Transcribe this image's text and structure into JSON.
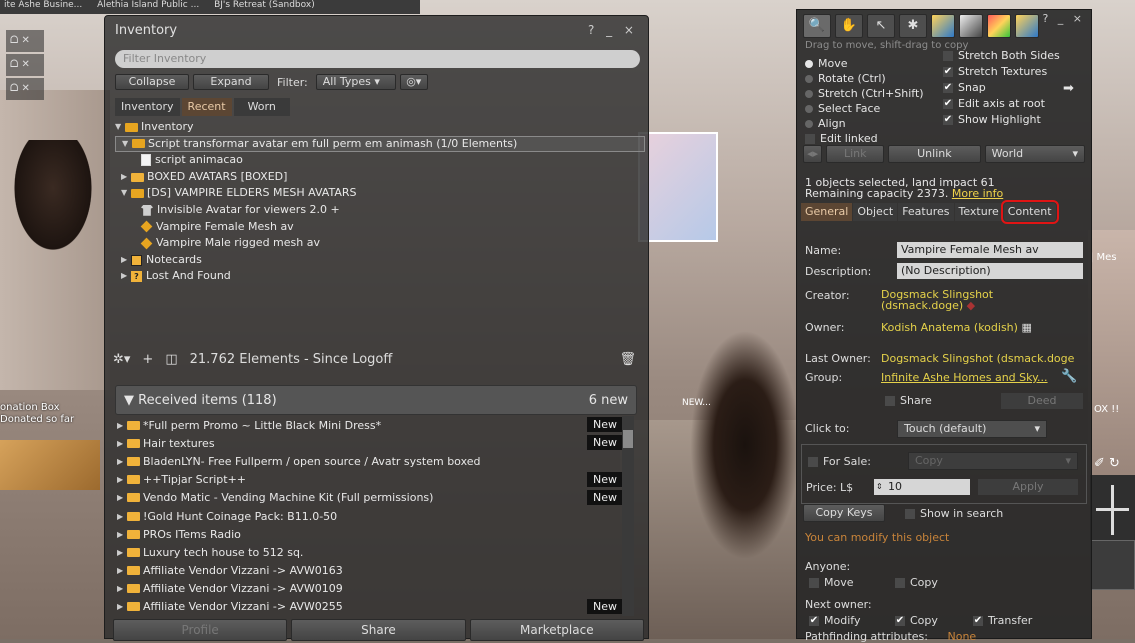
{
  "world": {
    "top_tabs": [
      "ite Ashe Busine...",
      "Alethia Island Public ...",
      "BJ's Retreat (Sandbox)"
    ],
    "left_icons": [
      "ᗝ ✕",
      "ᗝ ✕",
      "ᗝ ✕"
    ],
    "donation_line1": "onation Box",
    "donation_line2": "Donated so far",
    "new_label": "NEW...",
    "mes_label": "| Mes",
    "ox_label": "OX !!",
    "cam_glyph": "✐ ↻"
  },
  "inventory": {
    "title": "Inventory",
    "window_controls": "? _ ×",
    "filter_placeholder": "Filter Inventory",
    "collapse_label": "Collapse",
    "expand_label": "Expand",
    "filter_label": "Filter:",
    "filter_type": "All Types",
    "tabs": [
      "Inventory",
      "Recent",
      "Worn"
    ],
    "tree": [
      {
        "label": "Inventory"
      },
      {
        "label": "Script transformar avatar em full perm em animash (1/0 Elements)"
      },
      {
        "label": "script animacao"
      },
      {
        "label": "BOXED AVATARS [BOXED]"
      },
      {
        "label": "[DS] VAMPIRE ELDERS MESH AVATARS"
      },
      {
        "label": "Invisible Avatar for viewers 2.0 +"
      },
      {
        "label": "Vampire Female Mesh av"
      },
      {
        "label": "Vampire Male rigged mesh av"
      },
      {
        "label": "Notecards"
      },
      {
        "label": "Lost And Found"
      }
    ],
    "status_count": "21.762 Elements",
    "status_since": "- Since Logoff",
    "received_title": "Received items (118)",
    "received_new": "6 new",
    "received": [
      {
        "label": "*Full perm Promo ~ Little Black Mini Dress*",
        "tag": "New"
      },
      {
        "label": "Hair textures",
        "tag": "New"
      },
      {
        "label": "BladenLYN- Free Fullperm / open source / Avatr system boxed",
        "tag": ""
      },
      {
        "label": "++Tipjar Script++",
        "tag": "New"
      },
      {
        "label": "Vendo Matic - Vending Machine Kit (Full permissions)",
        "tag": "New"
      },
      {
        "label": "!Gold Hunt Coinage Pack: B11.0-50",
        "tag": ""
      },
      {
        "label": "PROs ITems Radio",
        "tag": ""
      },
      {
        "label": "Luxury tech house to 512 sq.",
        "tag": ""
      },
      {
        "label": "Affiliate Vendor Vizzani -> AVW0163",
        "tag": ""
      },
      {
        "label": "Affiliate Vendor Vizzani -> AVW0109",
        "tag": ""
      },
      {
        "label": "Affiliate Vendor Vizzani -> AVW0255",
        "tag": "New"
      }
    ],
    "bottom_buttons": [
      "Profile",
      "Share",
      "Marketplace"
    ]
  },
  "build": {
    "window_controls": "? _ ×",
    "drag_tip": "Drag to move, shift-drag to copy",
    "move": "Move",
    "rotate": "Rotate (Ctrl)",
    "stretch": "Stretch (Ctrl+Shift)",
    "select_face": "Select Face",
    "align": "Align",
    "edit_linked": "Edit linked",
    "stretch_both": "Stretch Both Sides",
    "stretch_textures": "Stretch Textures",
    "snap": "Snap",
    "edit_axis": "Edit axis at root",
    "show_highlight": "Show Highlight",
    "link_label": "Link",
    "unlink_label": "Unlink",
    "world_label": "World",
    "info_line1": "1 objects selected, land impact 61",
    "info_line2": "Remaining capacity 2373.",
    "more_info": "More info",
    "tabs": [
      "General",
      "Object",
      "Features",
      "Texture",
      "Content"
    ],
    "name_label": "Name:",
    "name_value": "Vampire Female Mesh av",
    "desc_label": "Description:",
    "desc_value": "(No Description)",
    "creator_label": "Creator:",
    "creator_value": "Dogsmack Slingshot",
    "creator_sub": "(dsmack.doge)",
    "owner_label": "Owner:",
    "owner_value": "Kodish Anatema (kodish)",
    "last_owner_label": "Last Owner:",
    "last_owner_value": "Dogsmack Slingshot (dsmack.doge",
    "group_label": "Group:",
    "group_value": "Infinite Ashe Homes and Sky...",
    "share_label": "Share",
    "deed_label": "Deed",
    "click_to_label": "Click to:",
    "click_to_value": "Touch (default)",
    "for_sale_label": "For Sale:",
    "copy_combo": "Copy",
    "price_label": "Price: L$",
    "price_value": "10",
    "apply_label": "Apply",
    "copy_keys": "Copy Keys",
    "show_in_search": "Show in search",
    "modify_note": "You can modify this object",
    "anyone_label": "Anyone:",
    "anyone_move": "Move",
    "anyone_copy": "Copy",
    "next_owner_label": "Next owner:",
    "next_modify": "Modify",
    "next_copy": "Copy",
    "next_transfer": "Transfer",
    "pathfinding_label": "Pathfinding attributes:",
    "pathfinding_value": "None"
  }
}
